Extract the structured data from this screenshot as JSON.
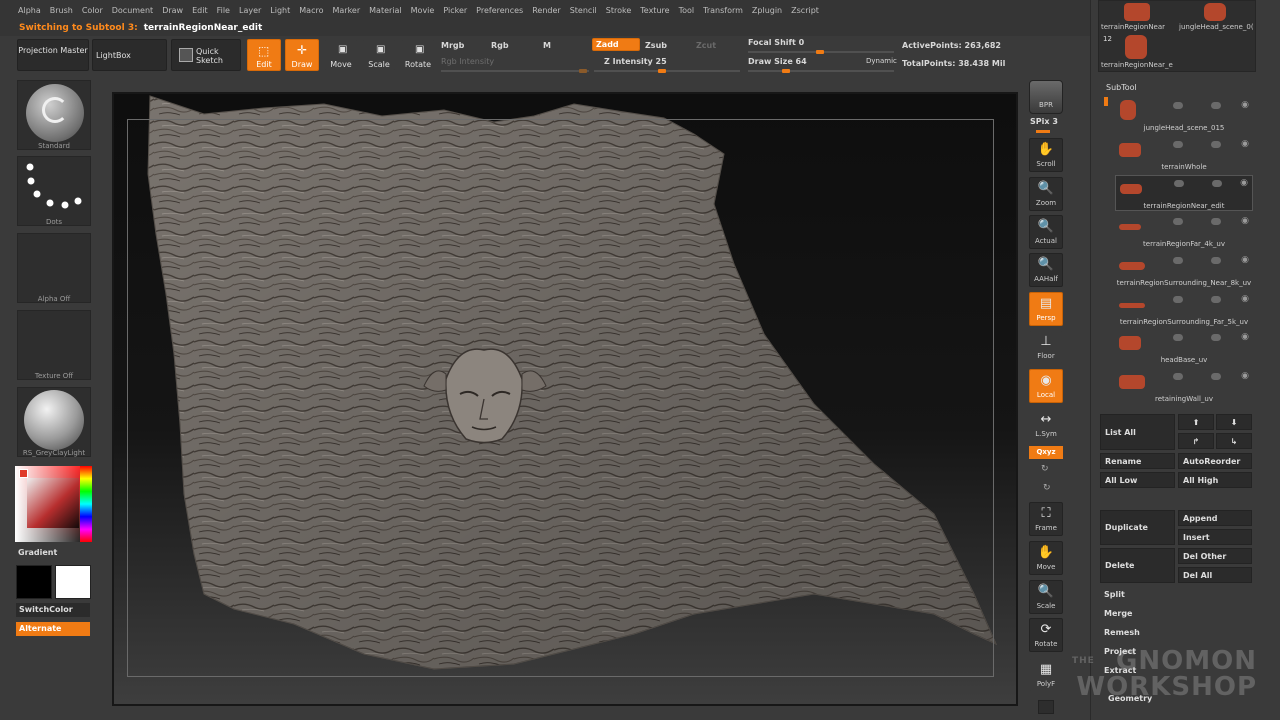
{
  "menu": [
    "Alpha",
    "Brush",
    "Color",
    "Document",
    "Draw",
    "Edit",
    "File",
    "Layer",
    "Light",
    "Macro",
    "Marker",
    "Material",
    "Movie",
    "Picker",
    "Preferences",
    "Render",
    "Stencil",
    "Stroke",
    "Texture",
    "Tool",
    "Transform",
    "Zplugin",
    "Zscript"
  ],
  "status": {
    "prefix": "Switching to Subtool 3:",
    "name": "terrainRegionNear_edit"
  },
  "toolbar": {
    "projection_master": "Projection Master",
    "lightbox": "LightBox",
    "quick_sketch": "Quick Sketch",
    "edit": "Edit",
    "draw": "Draw",
    "move": "Move",
    "scale": "Scale",
    "rotate": "Rotate",
    "mrgb": "Mrgb",
    "rgb": "Rgb",
    "m": "M",
    "rgb_intensity": "Rgb Intensity",
    "zadd": "Zadd",
    "zsub": "Zsub",
    "zcut": "Zcut",
    "z_intensity": "Z Intensity 25",
    "focal_shift": "Focal Shift 0",
    "draw_size": "Draw Size 64",
    "dynamic": "Dynamic",
    "active_points": "ActivePoints: 263,682",
    "total_points": "TotalPoints: 38.438 Mil"
  },
  "left": {
    "brush_label": "Standard",
    "stroke_label": "Dots",
    "alpha_label": "Alpha  Off",
    "texture_label": "Texture  Off",
    "material_label": "RS_GreyClayLight",
    "gradient": "Gradient",
    "switchcolor": "SwitchColor",
    "alternate": "Alternate"
  },
  "shelf": {
    "bpr": "BPR",
    "spix": "SPix 3",
    "scroll": "Scroll",
    "zoom": "Zoom",
    "actual": "Actual",
    "aahalf": "AAHalf",
    "persp": "Persp",
    "floor": "Floor",
    "local": "Local",
    "lsym": "L.Sym",
    "xyz": "Qxyz",
    "frame": "Frame",
    "move": "Move",
    "scale": "Scale",
    "rotate": "Rotate",
    "polyf": "PolyF"
  },
  "tool_thumbs": {
    "a": "terrainRegionNear",
    "b": "jungleHead_scene_0(",
    "count": "12",
    "c": "terrainRegionNear_e"
  },
  "subtool": {
    "title": "SubTool",
    "items": [
      "jungleHead_scene_015",
      "terrainWhole",
      "terrainRegionNear_edit",
      "terrainRegionFar_4k_uv",
      "terrainRegionSurrounding_Near_8k_uv",
      "terrainRegionSurrounding_Far_5k_uv",
      "headBase_uv",
      "retainingWall_uv"
    ]
  },
  "subtool_buttons": {
    "list_all": "List All",
    "rename": "Rename",
    "autoreorder": "AutoReorder",
    "all_low": "All Low",
    "all_high": "All High",
    "duplicate": "Duplicate",
    "append": "Append",
    "insert": "Insert",
    "delete": "Delete",
    "del_other": "Del Other",
    "del_all": "Del All",
    "split": "Split",
    "merge": "Merge",
    "remesh": "Remesh",
    "project": "Project",
    "extract": "Extract",
    "geometry": "Geometry"
  },
  "watermark": {
    "the": "THE",
    "line1": "GNOMON",
    "line2": "WORKSHOP"
  },
  "colors": {
    "accent": "#f07b14",
    "panel": "#3a3a3a",
    "dark": "#2b2b2b"
  }
}
